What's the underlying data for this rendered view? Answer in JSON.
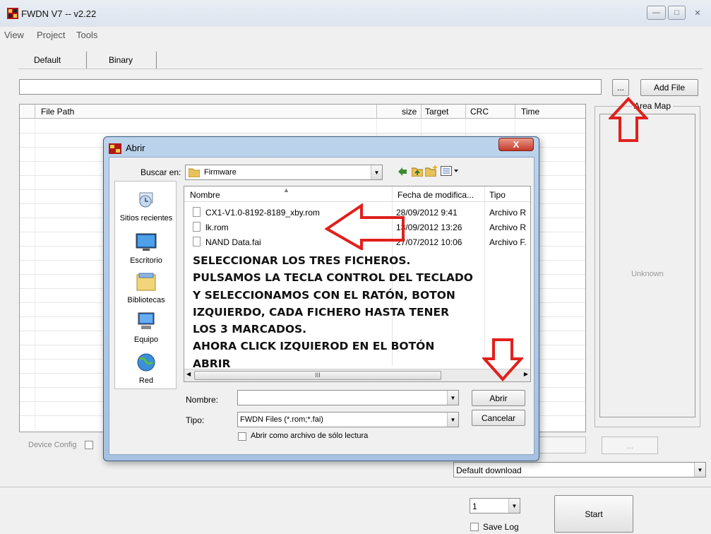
{
  "window": {
    "title": "FWDN V7 -- v2.22",
    "minimize": "—",
    "maximize": "□",
    "close": "✕"
  },
  "menu": [
    "View",
    "Project",
    "Tools"
  ],
  "tabs": [
    "Default",
    "Binary"
  ],
  "path_input": {
    "value": ""
  },
  "buttons": {
    "browse": "...",
    "add_file": "Add File"
  },
  "table": {
    "columns": [
      "File Path",
      "size",
      "Target",
      "CRC",
      "Time"
    ]
  },
  "area_map": {
    "legend": "Area Map",
    "state": "Unknown"
  },
  "device_config": {
    "label": "Device Config"
  },
  "disabled_button": "...",
  "download_mode": {
    "value": "Default download"
  },
  "count_select": {
    "value": "1"
  },
  "save_log": {
    "label": "Save Log",
    "checked": false
  },
  "start_button": "Start",
  "dialog": {
    "title": "Abrir",
    "close": "X",
    "look_in_label": "Buscar en:",
    "look_in_value": "Firmware",
    "places": [
      "Sitios recientes",
      "Escritorio",
      "Bibliotecas",
      "Equipo",
      "Red"
    ],
    "columns": [
      "Nombre",
      "Fecha de modifica...",
      "Tipo"
    ],
    "files": [
      {
        "name": "CX1-V1.0-8192-8189_xby.rom",
        "date": "28/09/2012 9:41",
        "type": "Archivo R"
      },
      {
        "name": "lk.rom",
        "date": "13/09/2012 13:26",
        "type": "Archivo R"
      },
      {
        "name": "NAND Data.fai",
        "date": "27/07/2012 10:06",
        "type": "Archivo F."
      }
    ],
    "scroll_thumb": "III",
    "name_label": "Nombre:",
    "name_value": "",
    "type_label": "Tipo:",
    "type_value": "FWDN Files (*.rom;*.fai)",
    "readonly_label": "Abrir como archivo de sólo lectura",
    "open_button": "Abrir",
    "cancel_button": "Cancelar"
  },
  "annotation": {
    "lines": [
      "SELECCIONAR LOS TRES FICHEROS.",
      "PULSAMOS LA TECLA CONTROL DEL TECLADO",
      "Y SELECCIONAMOS CON EL RATÓN, BOTON",
      "IZQUIERDO, CADA FICHERO HASTA TENER",
      "LOS 3 MARCADOS.",
      "AHORA CLICK IZQUIEROD EN EL BOTÓN",
      "ABRIR"
    ],
    "arrow_color": "#e0201c"
  }
}
